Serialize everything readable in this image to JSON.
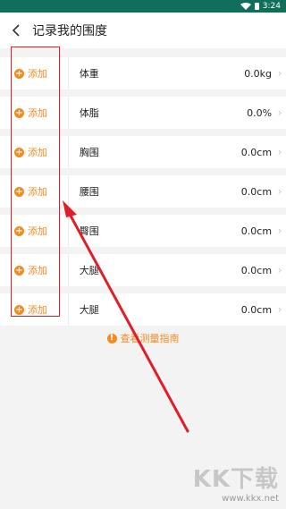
{
  "status_bar": {
    "time": "3:24"
  },
  "header": {
    "title": "记录我的围度",
    "back_icon": "chevron-left-icon"
  },
  "rows": [
    {
      "add_label": "添加",
      "name": "体重",
      "value": "0.0kg"
    },
    {
      "add_label": "添加",
      "name": "体脂",
      "value": "0.0%"
    },
    {
      "add_label": "添加",
      "name": "胸围",
      "value": "0.0cm"
    },
    {
      "add_label": "添加",
      "name": "腰围",
      "value": "0.0cm"
    },
    {
      "add_label": "添加",
      "name": "臀围",
      "value": "0.0cm"
    },
    {
      "add_label": "添加",
      "name": "大腿",
      "value": "0.0cm"
    },
    {
      "add_label": "添加",
      "name": "大腿",
      "value": "0.0cm"
    }
  ],
  "guide": {
    "label": "查看测量指南",
    "icon": "alert-circle-icon"
  },
  "watermark": {
    "brand": "KK下载",
    "url": "www.kkx.net"
  },
  "colors": {
    "accent": "#f28c22",
    "highlight": "#e21d2a",
    "status_bar": "#0f6f5b"
  }
}
